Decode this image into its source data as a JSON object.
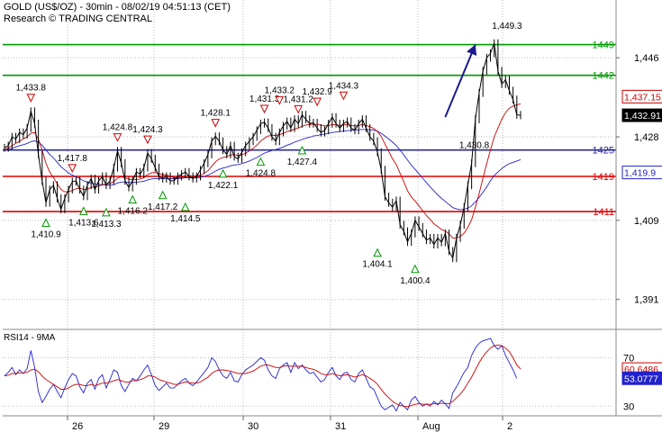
{
  "header": {
    "symbol_line": "GOLD (US$/OZ) - 30min - 08/02/19 04:51:13 (CET)",
    "research_line": "Research © TRADING CENTRAL"
  },
  "colors": {
    "price": "#000000",
    "ma_fast": "#cc0000",
    "ma_slow": "#2222cc",
    "resistance": "#009900",
    "pivot": "#2a2a9a",
    "support": "#dd0000",
    "trend": "#1a1a90",
    "grid": "#bbbbbb"
  },
  "chart_data": [
    {
      "type": "line",
      "title": "GOLD (US$/OZ) - 30min",
      "ylim": [
        1385,
        1453
      ],
      "y_ticks": [
        1391,
        1409,
        1428,
        1446
      ],
      "x_ticks": [
        "26",
        "29",
        "30",
        "31",
        "Aug",
        "2"
      ],
      "horizontal_levels": [
        {
          "value": 1449,
          "label": "1449",
          "kind": "resistance"
        },
        {
          "value": 1442,
          "label": "1442",
          "kind": "resistance"
        },
        {
          "value": 1425,
          "label": "1425",
          "kind": "pivot"
        },
        {
          "value": 1419,
          "label": "1419",
          "kind": "support"
        },
        {
          "value": 1411,
          "label": "1411",
          "kind": "support"
        }
      ],
      "last_price_tags": [
        {
          "label": "1,437.15",
          "color": "#cc0000",
          "value": 1437.15
        },
        {
          "label": "1,432.91",
          "color": "#000000",
          "value": 1432.91
        },
        {
          "label": "1,419.9",
          "color": "#2222cc",
          "value": 1419.9
        }
      ],
      "series": [
        {
          "role": "price",
          "color": "#000000",
          "values": [
            1425.5,
            1426,
            1428,
            1427.5,
            1429,
            1428.5,
            1430,
            1433.8,
            1431,
            1424,
            1418,
            1413,
            1416,
            1417,
            1414,
            1411.5,
            1414,
            1416,
            1417.8,
            1418,
            1416,
            1414.5,
            1417,
            1418.5,
            1416,
            1418,
            1419,
            1417,
            1418,
            1421,
            1424.8,
            1422,
            1418,
            1416.5,
            1418,
            1420,
            1419.5,
            1421,
            1424.3,
            1423,
            1421,
            1419,
            1418.5,
            1419,
            1418,
            1418,
            1419,
            1419.5,
            1420,
            1419,
            1418.5,
            1419,
            1420.5,
            1422,
            1424,
            1427,
            1428.1,
            1427,
            1425,
            1424,
            1426,
            1423.5,
            1423,
            1424.5,
            1426,
            1427,
            1428,
            1429.5,
            1431,
            1431.3,
            1430,
            1428,
            1427,
            1429,
            1430.5,
            1431.5,
            1430,
            1432,
            1431,
            1433,
            1432,
            1431,
            1431.2,
            1430,
            1429,
            1429.5,
            1431,
            1432.5,
            1431,
            1430,
            1431,
            1431.5,
            1430,
            1429.5,
            1431,
            1432,
            1430,
            1428,
            1427,
            1424.5,
            1420.5,
            1414.4,
            1413,
            1412,
            1413.5,
            1408,
            1406.5,
            1404.1,
            1406,
            1409,
            1407.5,
            1406,
            1404.5,
            1405,
            1403.5,
            1405,
            1404,
            1406,
            1402,
            1400.4,
            1405,
            1408,
            1412,
            1417,
            1422,
            1432,
            1438,
            1443,
            1446,
            1447,
            1449.3,
            1443,
            1440,
            1441,
            1438.5,
            1436.5,
            1433,
            1432.9
          ]
        },
        {
          "role": "ma_fast",
          "color": "#cc0000",
          "values": [
            1425,
            1425.5,
            1426,
            1426.5,
            1427,
            1427.5,
            1428,
            1428.8,
            1429,
            1427.5,
            1425,
            1422,
            1420,
            1418.7,
            1417.3,
            1416,
            1415.5,
            1415.5,
            1415.8,
            1416.2,
            1416.3,
            1416,
            1416.1,
            1416.5,
            1416.6,
            1416.8,
            1417.1,
            1417.2,
            1417.4,
            1417.8,
            1418.6,
            1418.9,
            1418.7,
            1418.4,
            1418.2,
            1418.3,
            1418.4,
            1418.7,
            1419.4,
            1419.8,
            1419.9,
            1419.6,
            1419.4,
            1419.3,
            1419,
            1418.7,
            1418.7,
            1418.8,
            1419,
            1419.1,
            1419.1,
            1419.1,
            1419.3,
            1419.7,
            1420.3,
            1421.3,
            1422.3,
            1423,
            1423.3,
            1423.5,
            1423.9,
            1423.9,
            1423.8,
            1423.9,
            1424.3,
            1424.8,
            1425.4,
            1426.1,
            1427,
            1427.7,
            1428.2,
            1428.3,
            1428.3,
            1428.5,
            1428.8,
            1429.2,
            1429.4,
            1429.8,
            1430,
            1430.4,
            1430.7,
            1430.8,
            1430.9,
            1430.8,
            1430.7,
            1430.5,
            1430.6,
            1430.8,
            1430.8,
            1430.6,
            1430.7,
            1430.8,
            1430.6,
            1430.5,
            1430.6,
            1430.8,
            1430.6,
            1430.3,
            1429.9,
            1429.2,
            1428.1,
            1426.4,
            1424.7,
            1423,
            1421.7,
            1419.7,
            1417.8,
            1415.7,
            1414.3,
            1413.4,
            1412.3,
            1411.2,
            1410.1,
            1409.2,
            1408.2,
            1407.6,
            1406.9,
            1406.6,
            1405.9,
            1405,
            1405,
            1405.3,
            1406.1,
            1407.4,
            1409.1,
            1412,
            1415.1,
            1418.6,
            1421.9,
            1425,
            1428,
            1430,
            1432,
            1433.5,
            1434.5,
            1435,
            1435.3,
            1435.5
          ]
        },
        {
          "role": "ma_slow",
          "color": "#2222cc",
          "values": [
            1425,
            1425.2,
            1425.4,
            1425.7,
            1426,
            1426.2,
            1426.5,
            1426.9,
            1427.1,
            1426.8,
            1426.1,
            1425,
            1424,
            1423.2,
            1422.2,
            1421.2,
            1420.5,
            1419.8,
            1419.3,
            1418.9,
            1418.5,
            1418,
            1417.7,
            1417.5,
            1417.3,
            1417.2,
            1417.1,
            1417,
            1417,
            1417.1,
            1417.5,
            1417.7,
            1417.7,
            1417.6,
            1417.6,
            1417.7,
            1417.8,
            1417.9,
            1418.2,
            1418.4,
            1418.5,
            1418.5,
            1418.5,
            1418.5,
            1418.5,
            1418.5,
            1418.5,
            1418.6,
            1418.7,
            1418.7,
            1418.7,
            1418.7,
            1418.8,
            1419,
            1419.3,
            1419.7,
            1420.2,
            1420.6,
            1420.9,
            1421.1,
            1421.4,
            1421.6,
            1421.7,
            1421.9,
            1422.2,
            1422.5,
            1422.9,
            1423.3,
            1423.8,
            1424.3,
            1424.6,
            1424.9,
            1425.1,
            1425.4,
            1425.7,
            1426.1,
            1426.4,
            1426.8,
            1427.1,
            1427.4,
            1427.7,
            1427.9,
            1428.2,
            1428.3,
            1428.5,
            1428.6,
            1428.8,
            1429,
            1429.1,
            1429.2,
            1429.3,
            1429.4,
            1429.5,
            1429.5,
            1429.6,
            1429.7,
            1429.7,
            1429.6,
            1429.5,
            1429.3,
            1428.8,
            1428.2,
            1427.5,
            1426.8,
            1426,
            1425,
            1423.9,
            1422.7,
            1421.6,
            1420.6,
            1419.6,
            1418.6,
            1417.6,
            1416.6,
            1415.7,
            1414.8,
            1414,
            1413.3,
            1412.6,
            1411.9,
            1411.6,
            1411.4,
            1411.5,
            1411.8,
            1412.3,
            1413.2,
            1414.2,
            1415.4,
            1416.6,
            1418,
            1419.2,
            1420,
            1420.8,
            1421.4,
            1421.9,
            1422.2,
            1422.5,
            1422.8
          ]
        }
      ],
      "annotations": [
        {
          "label": "1,433.8",
          "marker": "down",
          "index": 7,
          "value": 1433.8
        },
        {
          "label": "1,417.8",
          "marker": "down",
          "index": 18,
          "value": 1417.8
        },
        {
          "label": "1,424.8",
          "marker": "down",
          "index": 30,
          "value": 1424.8
        },
        {
          "label": "1,424.3",
          "marker": "down",
          "index": 38,
          "value": 1424.3
        },
        {
          "label": "1,428.1",
          "marker": "down",
          "index": 56,
          "value": 1428.1
        },
        {
          "label": "1,431.3",
          "marker": "down",
          "index": 69,
          "value": 1431.3
        },
        {
          "label": "1,433.2",
          "marker": "down",
          "index": 73,
          "value": 1433.2
        },
        {
          "label": "1,431.2",
          "marker": "down",
          "index": 78,
          "value": 1431.2
        },
        {
          "label": "1,432.9",
          "marker": "down",
          "index": 83,
          "value": 1432.9
        },
        {
          "label": "1,434.3",
          "marker": "down",
          "index": 90,
          "value": 1434.3
        },
        {
          "label": "1,449.3",
          "marker": "none",
          "index": 131,
          "value": 1449.3
        },
        {
          "label": "1,410.9",
          "marker": "up",
          "index": 11,
          "value": 1410.9
        },
        {
          "label": "1,413.6",
          "marker": "up",
          "index": 21,
          "value": 1413.6
        },
        {
          "label": "1,413.3",
          "marker": "up",
          "index": 27,
          "value": 1413.3
        },
        {
          "label": "1,416.2",
          "marker": "up",
          "index": 34,
          "value": 1416.2
        },
        {
          "label": "1,417.2",
          "marker": "up",
          "index": 42,
          "value": 1417.2
        },
        {
          "label": "1,414.5",
          "marker": "up",
          "index": 48,
          "value": 1414.5
        },
        {
          "label": "1,422.1",
          "marker": "up",
          "index": 58,
          "value": 1422.1
        },
        {
          "label": "1,424.8",
          "marker": "up",
          "index": 68,
          "value": 1424.8
        },
        {
          "label": "1,427.4",
          "marker": "up",
          "index": 79,
          "value": 1427.4
        },
        {
          "label": "1,404.1",
          "marker": "up",
          "index": 99,
          "value": 1404.1
        },
        {
          "label": "1,400.4",
          "marker": "up",
          "index": 109,
          "value": 1400.4
        },
        {
          "label": "1,430.8",
          "marker": "none",
          "index": 118,
          "value": 1430.8
        }
      ],
      "forecast_arrow": {
        "from": [
          117,
          1432.5
        ],
        "to": [
          125,
          1449
        ]
      }
    },
    {
      "type": "line",
      "title": "RSI14 - 9MA",
      "ylim": [
        22,
        92
      ],
      "y_ticks": [
        30,
        70
      ],
      "last_value_tags": [
        {
          "label": "60.6486",
          "color": "#cc0000",
          "value": 60.6486
        },
        {
          "label": "53.0777",
          "color": "#2222cc",
          "value": 53.0777
        }
      ],
      "series": [
        {
          "role": "rsi",
          "color": "#2222cc",
          "values": [
            55,
            58,
            62,
            56,
            60,
            57,
            61,
            76,
            62,
            42,
            33,
            38,
            44,
            48,
            42,
            37,
            45,
            52,
            57,
            55,
            46,
            41,
            49,
            52,
            44,
            53,
            56,
            45,
            52,
            60,
            58,
            47,
            42,
            48,
            53,
            51,
            55,
            60,
            64,
            56,
            47,
            43,
            46,
            49,
            45,
            45,
            48,
            51,
            53,
            49,
            47,
            50,
            54,
            58,
            62,
            70,
            67,
            60,
            55,
            53,
            58,
            51,
            50,
            56,
            60,
            62,
            64,
            67,
            70,
            68,
            60,
            55,
            53,
            61,
            64,
            66,
            58,
            66,
            61,
            64,
            60,
            57,
            58,
            54,
            50,
            52,
            58,
            62,
            55,
            52,
            57,
            58,
            52,
            50,
            57,
            60,
            53,
            46,
            44,
            37,
            30,
            27,
            29,
            31,
            26,
            33,
            30,
            27,
            35,
            38,
            33,
            30,
            32,
            30,
            34,
            31,
            35,
            32,
            28,
            41,
            46,
            52,
            58,
            62,
            72,
            78,
            82,
            84,
            85,
            86,
            80,
            77,
            80,
            72,
            66,
            60,
            53
          ]
        },
        {
          "role": "rsi_ma",
          "color": "#cc0000",
          "values": [
            55,
            55.5,
            57,
            57,
            57.5,
            57.5,
            58,
            60,
            60.5,
            58.5,
            55,
            52,
            50,
            48,
            46,
            44,
            44,
            45,
            47,
            48,
            48,
            47,
            47,
            48,
            47,
            48,
            49,
            49,
            50,
            51,
            52,
            51,
            50,
            50,
            51,
            51,
            52,
            53,
            55,
            55,
            54,
            52,
            51,
            50,
            49,
            48,
            48,
            49,
            50,
            49.5,
            49,
            49,
            50,
            52,
            54,
            57,
            59,
            60,
            60,
            59.5,
            59,
            58,
            57,
            57,
            57,
            58,
            59,
            61,
            63,
            64,
            64,
            63,
            62,
            62,
            63,
            63.5,
            63,
            63,
            63,
            63,
            62,
            61,
            60.5,
            59,
            57,
            56,
            56,
            57,
            56,
            55,
            55.5,
            56,
            55,
            54,
            55,
            56,
            55,
            53,
            51,
            48,
            44,
            40,
            37,
            34,
            32,
            30.5,
            30,
            29.5,
            30.5,
            31.5,
            32,
            31.5,
            31.5,
            31.5,
            32,
            32,
            32.5,
            32,
            32,
            34,
            37,
            40,
            44,
            49,
            54,
            60,
            66,
            71,
            75,
            78,
            80,
            80.5,
            80,
            78,
            75,
            70,
            64,
            60.6486
          ]
        }
      ]
    }
  ]
}
